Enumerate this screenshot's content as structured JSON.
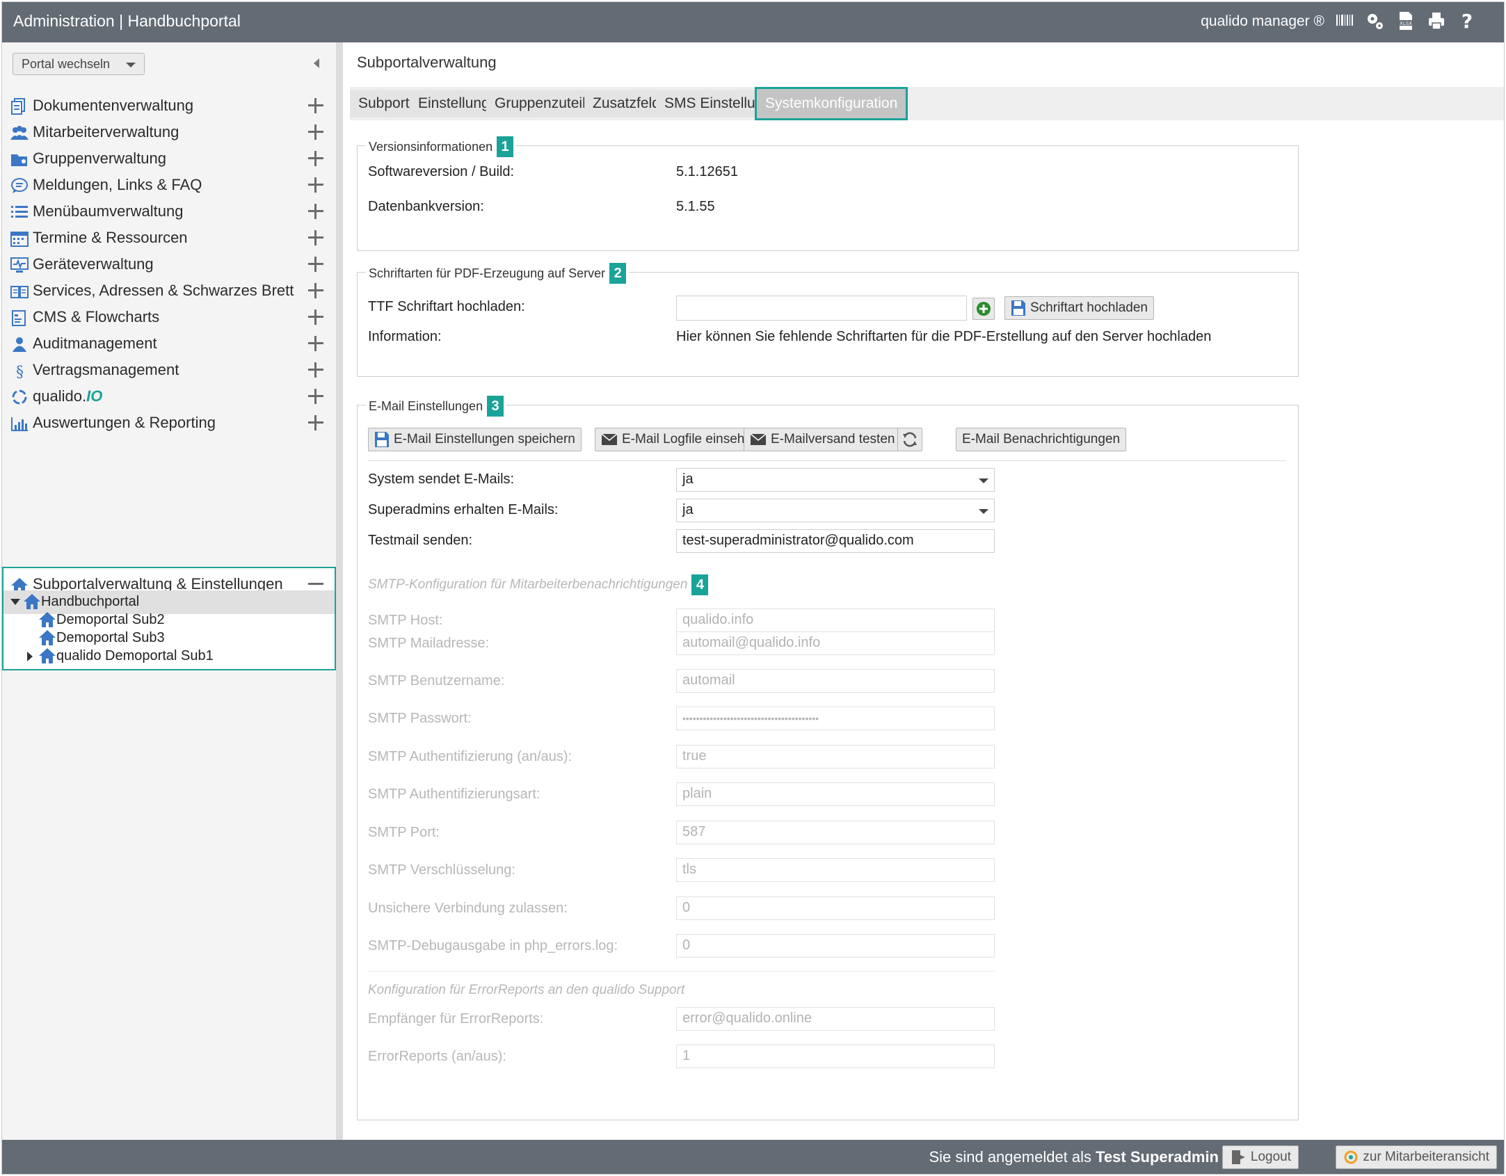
{
  "header": {
    "title": "Administration | Handbuchportal",
    "brand": "qualido manager ®",
    "icons": [
      "barcode-icon",
      "gears-icon",
      "xlsx-icon",
      "print-icon",
      "help-icon"
    ]
  },
  "sidebar": {
    "portal_select": "Portal wechseln",
    "items": [
      {
        "label": "Dokumentenverwaltung",
        "icon": "documents-icon"
      },
      {
        "label": "Mitarbeiterverwaltung",
        "icon": "users-icon"
      },
      {
        "label": "Gruppenverwaltung",
        "icon": "group-folder-icon"
      },
      {
        "label": "Meldungen, Links & FAQ",
        "icon": "chat-bubble-icon"
      },
      {
        "label": "Menübaumverwaltung",
        "icon": "list-icon"
      },
      {
        "label": "Termine & Ressourcen",
        "icon": "calendar-icon"
      },
      {
        "label": "Geräteverwaltung",
        "icon": "device-monitor-icon"
      },
      {
        "label": "Services, Adressen & Schwarzes Brett",
        "icon": "book-icon"
      },
      {
        "label": "CMS & Flowcharts",
        "icon": "cms-icon"
      },
      {
        "label": "Auditmanagement",
        "icon": "auditor-icon"
      },
      {
        "label": "Vertragsmanagement",
        "icon": "paragraph-icon"
      },
      {
        "label": "qualido.",
        "label_suffix": "IO",
        "icon": "qualido-io-icon"
      },
      {
        "label": "Auswertungen & Reporting",
        "icon": "bar-chart-icon"
      }
    ],
    "expanded": {
      "label": "Subportalverwaltung & Einstellungen",
      "tree": {
        "root": "Handbuchportal",
        "children": [
          "Demoportal Sub2",
          "Demoportal Sub3",
          "qualido Demoportal Sub1"
        ]
      }
    }
  },
  "main": {
    "title": "Subportalverwaltung",
    "tabs": [
      "Subportal",
      "Einstellungen",
      "Gruppenzuteilung",
      "Zusatzfelder",
      "SMS Einstellungen",
      "Systemkonfiguration"
    ],
    "active_tab": "Systemkonfiguration",
    "version": {
      "legend": "Versionsinformationen",
      "badge": "1",
      "software_label": "Softwareversion / Build:",
      "software_value": "5.1.12651",
      "db_label": "Datenbankversion:",
      "db_value": "5.1.55"
    },
    "fonts": {
      "legend": "Schriftarten für PDF-Erzeugung auf Server",
      "badge": "2",
      "upload_label": "TTF Schriftart hochladen:",
      "upload_value": "",
      "upload_button": "Schriftart hochladen",
      "info_label": "Information:",
      "info_value": "Hier können Sie fehlende Schriftarten für die PDF-Erstellung auf den Server hochladen"
    },
    "email": {
      "legend": "E-Mail Einstellungen",
      "badge": "3",
      "buttons": {
        "save": "E-Mail Einstellungen speichern",
        "logfile": "E-Mail Logfile einsehen",
        "test": "E-Mailversand testen",
        "notifications": "E-Mail Benachrichtigungen"
      },
      "system_sends_label": "System sendet E-Mails:",
      "system_sends_value": "ja",
      "superadmins_label": "Superadmins erhalten E-Mails:",
      "superadmins_value": "ja",
      "testmail_label": "Testmail senden:",
      "testmail_value": "test-superadministrator@qualido.com",
      "smtp_heading": "SMTP-Konfiguration für Mitarbeiterbenachrichtigungen",
      "smtp_badge": "4",
      "smtp": [
        {
          "label": "SMTP Host:",
          "value": "qualido.info"
        },
        {
          "label": "SMTP Mailadresse:",
          "value": "automail@qualido.info"
        },
        {
          "label": "SMTP Benutzername:",
          "value": "automail"
        },
        {
          "label": "SMTP Passwort:",
          "value": "••••••••••••••••••••••••••••••••••••••••"
        },
        {
          "label": "SMTP Authentifizierung (an/aus):",
          "value": "true"
        },
        {
          "label": "SMTP Authentifizierungsart:",
          "value": "plain"
        },
        {
          "label": "SMTP Port:",
          "value": "587"
        },
        {
          "label": "SMTP Verschlüsselung:",
          "value": "tls"
        },
        {
          "label": "Unsichere Verbindung zulassen:",
          "value": "0"
        },
        {
          "label": "SMTP-Debugausgabe in php_errors.log:",
          "value": "0"
        }
      ],
      "error_heading": "Konfiguration für ErrorReports an den qualido Support",
      "error": [
        {
          "label": "Empfänger für ErrorReports:",
          "value": "error@qualido.online"
        },
        {
          "label": "ErrorReports (an/aus):",
          "value": "1"
        }
      ]
    }
  },
  "footer": {
    "prefix": "Sie sind angemeldet als ",
    "user": "Test Superadmin",
    "logout": "Logout",
    "employee_view": "zur Mitarbeiteransicht"
  },
  "colors": {
    "accent": "#1aa398",
    "header_bg": "#636b75",
    "icon_blue": "#3a77c4"
  }
}
